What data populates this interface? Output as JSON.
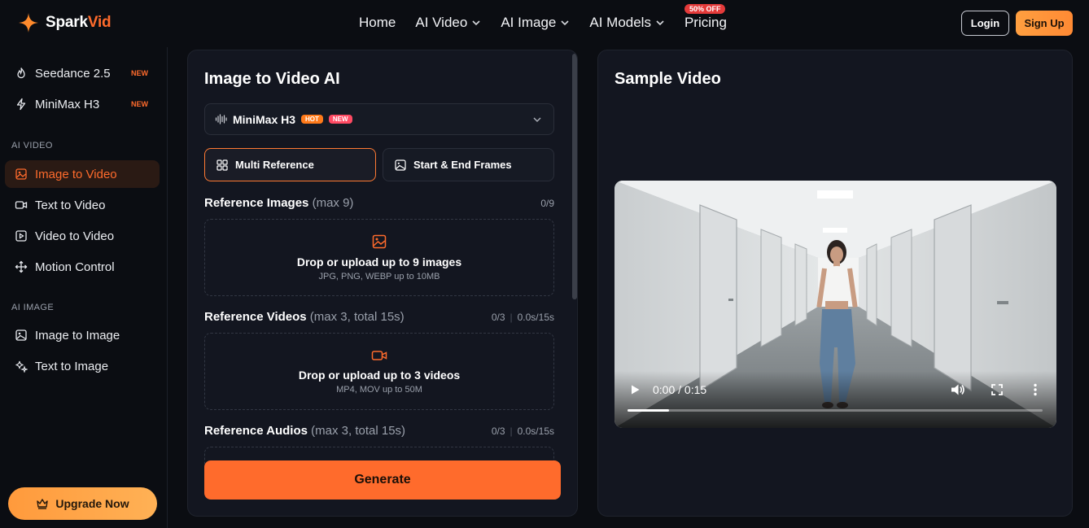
{
  "brand": {
    "name_a": "Spark",
    "name_b": "Vid",
    "accent": "#ff6b2c"
  },
  "nav": {
    "items": [
      "Home",
      "AI Video",
      "AI Image",
      "AI Models",
      "Pricing"
    ],
    "pricing_badge": "50% OFF",
    "login": "Login",
    "signup": "Sign Up"
  },
  "sidebar": {
    "top_items": [
      {
        "label": "Seedance 2.5",
        "badge": "NEW"
      },
      {
        "label": "MiniMax H3",
        "badge": "NEW"
      }
    ],
    "sections": [
      {
        "title": "AI VIDEO",
        "items": [
          "Image to Video",
          "Text to Video",
          "Video to Video",
          "Motion Control"
        ]
      },
      {
        "title": "AI IMAGE",
        "items": [
          "Image to Image",
          "Text to Image"
        ]
      }
    ],
    "active_item": "Image to Video",
    "upgrade": "Upgrade Now"
  },
  "form": {
    "title": "Image to Video AI",
    "model": {
      "name": "MiniMax H3",
      "badges": [
        "HOT",
        "NEW"
      ]
    },
    "modes": [
      "Multi Reference",
      "Start & End Frames"
    ],
    "selected_mode": "Multi Reference",
    "images": {
      "label": "Reference Images",
      "limit": "(max 9)",
      "count": "0/9",
      "drop_title": "Drop or upload up to 9 images",
      "drop_sub": "JPG, PNG, WEBP up to 10MB"
    },
    "videos": {
      "label": "Reference Videos",
      "limit": "(max 3, total 15s)",
      "count": "0/3",
      "duration": "0.0s/15s",
      "drop_title": "Drop or upload up to 3 videos",
      "drop_sub": "MP4, MOV up to 50M"
    },
    "audios": {
      "label": "Reference Audios",
      "limit": "(max 3, total 15s)",
      "count": "0/3",
      "duration": "0.0s/15s"
    },
    "generate": "Generate"
  },
  "sample": {
    "title": "Sample Video",
    "time": "0:00 / 0:15",
    "progress_fraction": 0.1
  }
}
